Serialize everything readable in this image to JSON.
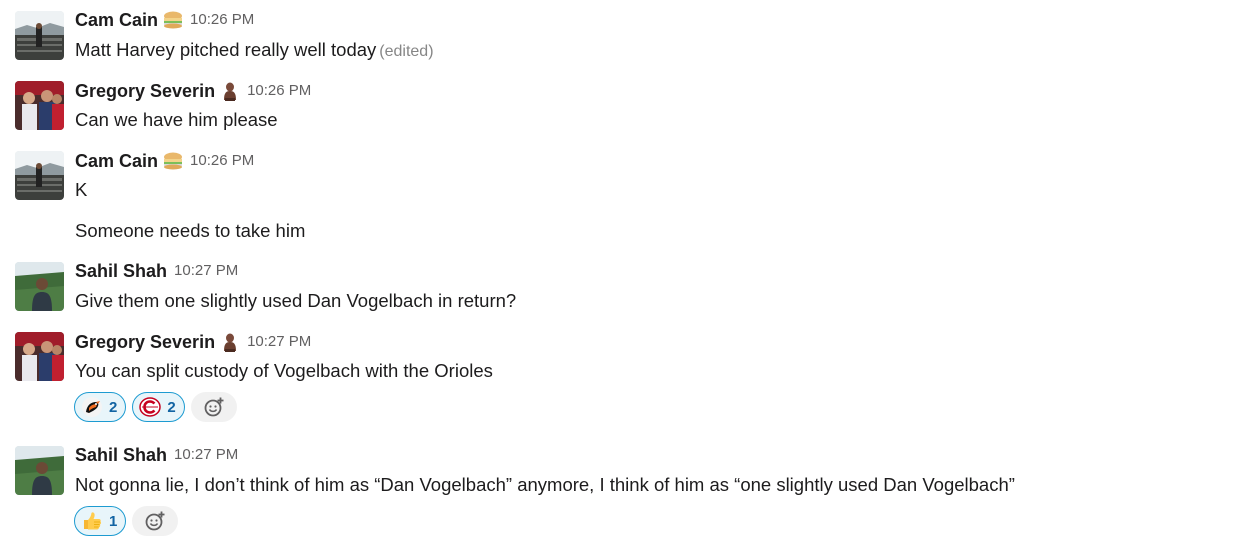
{
  "messages": [
    {
      "author": "Cam Cain",
      "status_icon": "sandwich-icon",
      "time": "10:26 PM",
      "lines": [
        "Matt Harvey pitched really well today"
      ],
      "edited_label": "(edited)"
    },
    {
      "author": "Gregory Severin",
      "status_icon": "bust-icon",
      "time": "10:26 PM",
      "lines": [
        "Can we have him please"
      ]
    },
    {
      "author": "Cam Cain",
      "status_icon": "sandwich-icon",
      "time": "10:26 PM",
      "lines": [
        "K",
        "Someone needs to take him"
      ]
    },
    {
      "author": "Sahil Shah",
      "time": "10:27 PM",
      "lines": [
        "Give them one slightly used Dan Vogelbach in return?"
      ]
    },
    {
      "author": "Gregory Severin",
      "status_icon": "bust-icon",
      "time": "10:27 PM",
      "lines": [
        "You can split custody of Vogelbach with the Orioles"
      ],
      "reactions": [
        {
          "icon": "orioles-bird-icon",
          "count": "2"
        },
        {
          "icon": "reds-c-icon",
          "count": "2"
        }
      ]
    },
    {
      "author": "Sahil Shah",
      "time": "10:27 PM",
      "lines": [
        "Not gonna lie, I don’t think of him as “Dan Vogelbach” anymore, I think of him as “one slightly used Dan Vogelbach”"
      ],
      "reactions": [
        {
          "icon": "thumbs-up-icon",
          "count": "1"
        }
      ]
    }
  ],
  "colors": {
    "text": "#1d1c1d",
    "muted": "#616061",
    "reaction_border": "#1d9bd1",
    "reaction_bg": "#e8f5fa",
    "reaction_count": "#1264a3"
  }
}
